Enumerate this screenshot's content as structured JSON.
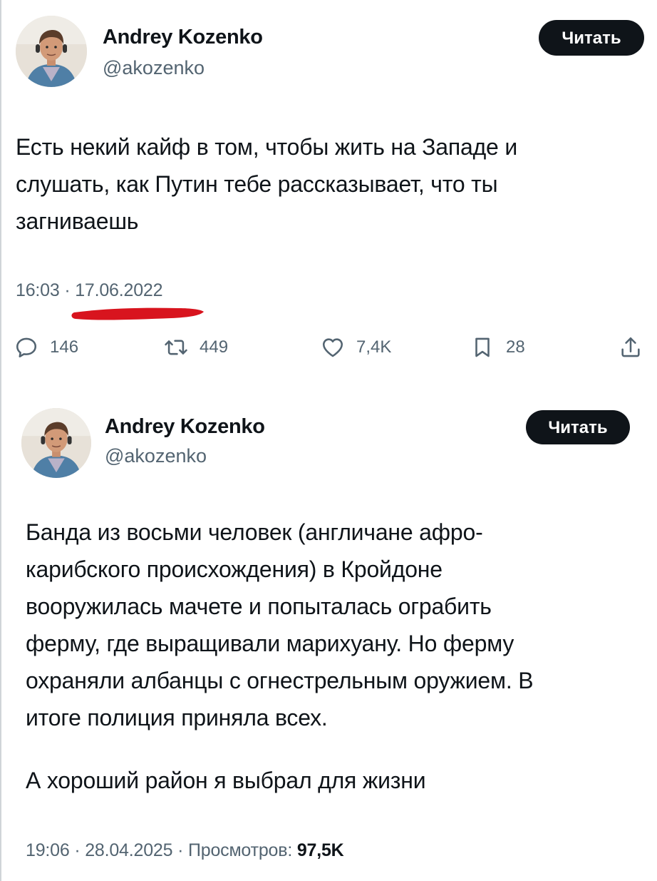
{
  "tweets": [
    {
      "author": {
        "name": "Andrey Kozenko",
        "handle": "@akozenko",
        "avatar": "avatar-photo"
      },
      "follow_label": "Читать",
      "text": "Есть некий кайф в том, чтобы жить на Западе и\nслушать, как Путин тебе рассказывает, что ты\nзагниваешь",
      "time": "16:03",
      "separator": "·",
      "date": "17.06.2022",
      "highlight_color": "#d8141e",
      "actions": {
        "reply": {
          "icon": "reply-icon",
          "count": "146"
        },
        "retweet": {
          "icon": "retweet-icon",
          "count": "449"
        },
        "like": {
          "icon": "heart-icon",
          "count": "7,4K"
        },
        "bookmark": {
          "icon": "bookmark-icon",
          "count": "28"
        },
        "share": {
          "icon": "share-icon"
        }
      }
    },
    {
      "author": {
        "name": "Andrey Kozenko",
        "handle": "@akozenko",
        "avatar": "avatar-photo"
      },
      "follow_label": "Читать",
      "text_paragraph_1": "Банда из восьми человек (англичане афро-\nкарибского происхождения) в Кройдоне\nвооружилась мачете и попыталась ограбить\nферму, где выращивали марихуану. Но ферму\nохраняли албанцы с огнестрельным оружием. В\nитоге полиция приняла всех.",
      "text_paragraph_2": "А хороший район я выбрал для жизни",
      "time": "19:06",
      "separator": "·",
      "date": "28.04.2025",
      "views_label": "Просмотров:",
      "views_count": "97,5K"
    }
  ],
  "colors": {
    "text": "#0f1419",
    "secondary": "#536471",
    "button_bg": "#0f1419",
    "button_text": "#ffffff"
  }
}
